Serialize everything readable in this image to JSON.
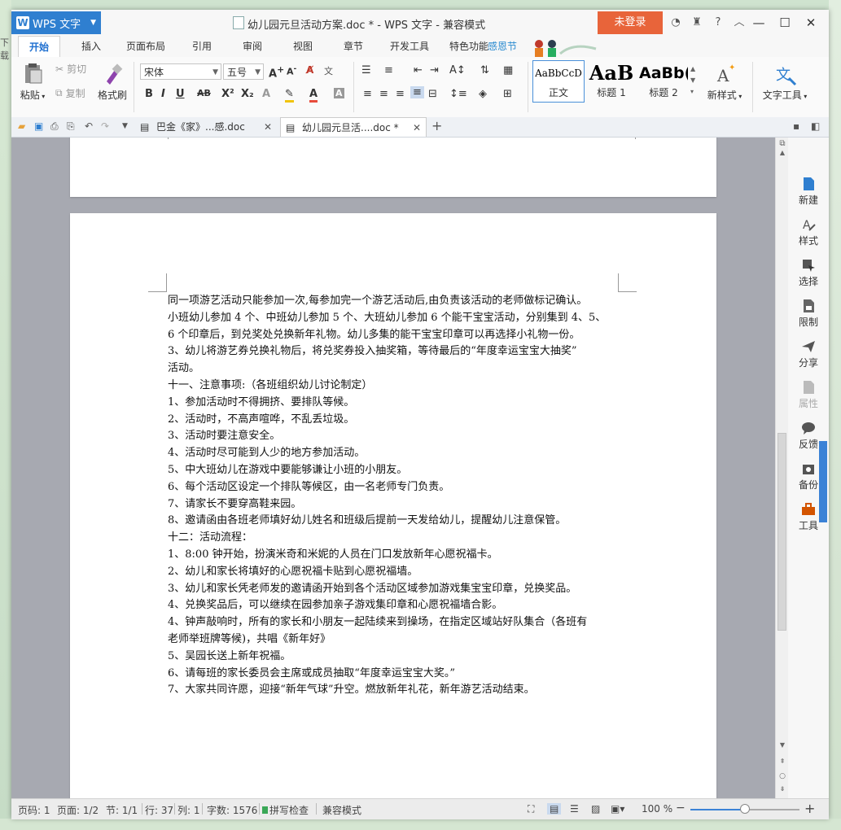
{
  "desktop": {
    "left_text": "下载"
  },
  "window": {
    "app_button": "WPS 文字",
    "title": "幼儿园元旦活动方案.doc * - WPS 文字 - 兼容模式",
    "login_button": "未登录",
    "help_icon": "?"
  },
  "ribbon_tabs": [
    "开始",
    "插入",
    "页面布局",
    "引用",
    "审阅",
    "视图",
    "章节",
    "开发工具",
    "特色功能"
  ],
  "festival_label": "感恩节",
  "ribbon": {
    "paste": "粘贴",
    "cut": "剪切",
    "copy": "复制",
    "format_painter": "格式刷",
    "font_name": "宋体",
    "font_size": "五号",
    "styles": [
      {
        "sample": "AaBbCcD",
        "name": "正文"
      },
      {
        "sample": "AaB",
        "name": "标题 1"
      },
      {
        "sample": "AaBb(",
        "name": "标题 2"
      }
    ],
    "new_style": "新样式",
    "text_tools": "文字工具"
  },
  "doc_tabs": [
    {
      "label": "巴金《家》...感.doc",
      "active": false
    },
    {
      "label": "幼儿园元旦活....doc *",
      "active": true
    }
  ],
  "document_lines": [
    "同一项游艺活动只能参加一次,每参加完一个游艺活动后,由负责该活动的老师做标记确认。",
    "小班幼儿参加 4 个、中班幼儿参加 5 个、大班幼儿参加 6 个能干宝宝活动，分别集到 4、5、",
    "6 个印章后，到兑奖处兑换新年礼物。幼儿多集的能干宝宝印章可以再选择小礼物一份。",
    "3、幼儿将游艺券兑换礼物后，将兑奖券投入抽奖箱，等待最后的“年度幸运宝宝大抽奖”",
    "活动。",
    "十一、注意事项:（各班组织幼儿讨论制定）",
    "1、参加活动时不得拥挤、要排队等候。",
    "2、活动时，不高声喧哗，不乱丢垃圾。",
    "3、活动时要注意安全。",
    "4、活动时尽可能到人少的地方参加活动。",
    "5、中大班幼儿在游戏中要能够谦让小班的小朋友。",
    "6、每个活动区设定一个排队等候区，由一名老师专门负责。",
    "7、请家长不要穿高鞋来园。",
    "8、邀请函由各班老师填好幼儿姓名和班级后提前一天发给幼儿，提醒幼儿注意保管。",
    "十二：活动流程：",
    "1、8:00 钟开始，扮演米奇和米妮的人员在门口发放新年心愿祝福卡。",
    "2、幼儿和家长将填好的心愿祝福卡贴到心愿祝福墙。",
    "3、幼儿和家长凭老师发的邀请函开始到各个活动区域参加游戏集宝宝印章，兑换奖品。",
    "4、兑换奖品后，可以继续在园参加亲子游戏集印章和心愿祝福墙合影。",
    "4、钟声敲响时，所有的家长和小朋友一起陆续来到操场，在指定区域站好队集合（各班有",
    "老师举班牌等候)，共唱《新年好》",
    "5、吴园长送上新年祝福。",
    "6、请每班的家长委员会主席或成员抽取“年度幸运宝宝大奖。”",
    "7、大家共同许愿，迎接“新年气球”升空。燃放新年礼花，新年游艺活动结束。"
  ],
  "task_pane": [
    "新建",
    "样式",
    "选择",
    "限制",
    "分享",
    "属性",
    "反馈",
    "备份",
    "工具"
  ],
  "status": {
    "page_code": "页码: 1",
    "pages": "页面: 1/2",
    "section": "节: 1/1",
    "row": "行: 37",
    "col": "列: 1",
    "words": "字数: 1576",
    "spell": "拼写检查",
    "mode": "兼容模式",
    "zoom": "100 %",
    "zoom_level": 0.5
  },
  "colors": {
    "accent": "#2f7fd0",
    "login": "#e8643a",
    "tab_active": "#1e6fd0"
  }
}
